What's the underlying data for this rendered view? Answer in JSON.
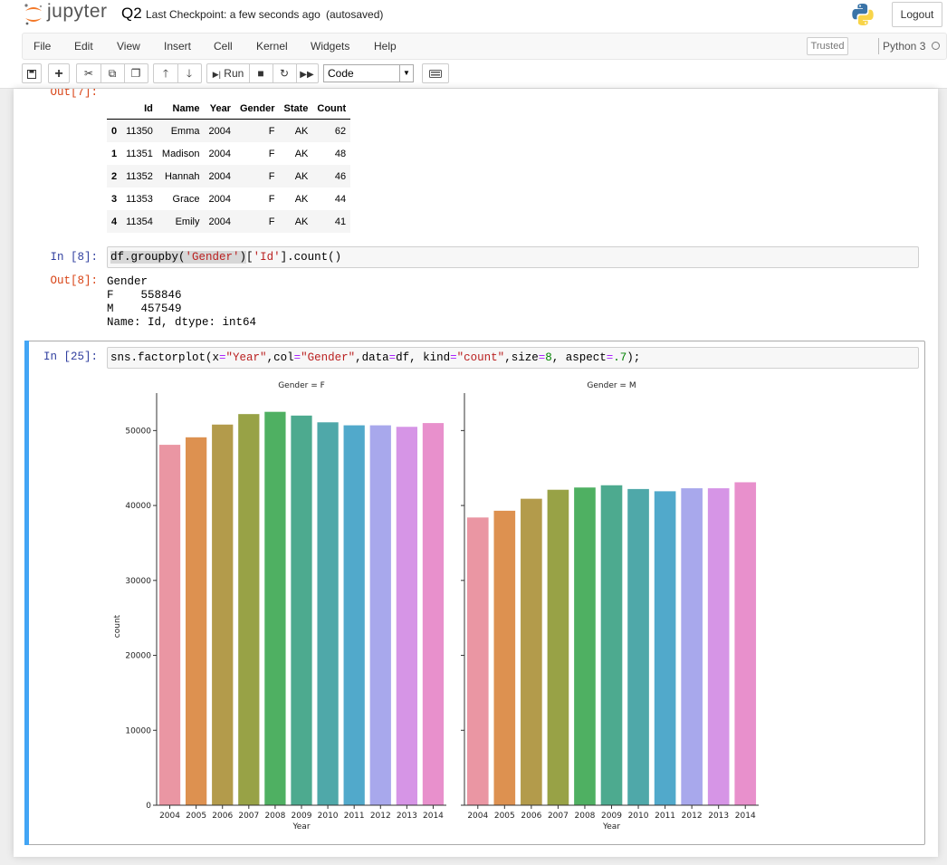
{
  "header": {
    "logo_text": "jupyter",
    "notebook_name": "Q2",
    "checkpoint": "Last Checkpoint: a few seconds ago",
    "autosave": "(autosaved)",
    "logout_label": "Logout"
  },
  "menubar": {
    "items": [
      "File",
      "Edit",
      "View",
      "Insert",
      "Cell",
      "Kernel",
      "Widgets",
      "Help"
    ],
    "trusted_label": "Trusted",
    "kernel_name": "Python 3"
  },
  "toolbar": {
    "run_label": "Run",
    "cell_type": "Code"
  },
  "cells": {
    "out7": {
      "prompt": "Out[7]:",
      "columns": [
        "",
        "Id",
        "Name",
        "Year",
        "Gender",
        "State",
        "Count"
      ],
      "rows": [
        [
          "0",
          "11350",
          "Emma",
          "2004",
          "F",
          "AK",
          "62"
        ],
        [
          "1",
          "11351",
          "Madison",
          "2004",
          "F",
          "AK",
          "48"
        ],
        [
          "2",
          "11352",
          "Hannah",
          "2004",
          "F",
          "AK",
          "46"
        ],
        [
          "3",
          "11353",
          "Grace",
          "2004",
          "F",
          "AK",
          "44"
        ],
        [
          "4",
          "11354",
          "Emily",
          "2004",
          "F",
          "AK",
          "41"
        ]
      ]
    },
    "in8": {
      "prompt": "In [8]:",
      "code": "df.groupby('Gender')['Id'].count()"
    },
    "out8": {
      "prompt": "Out[8]:",
      "lines": [
        "Gender",
        "F    558846",
        "M    457549",
        "Name: Id, dtype: int64"
      ]
    },
    "in25": {
      "prompt": "In [25]:",
      "code": "sns.factorplot(x=\"Year\",col=\"Gender\",data=df, kind=\"count\",size=8, aspect=.7);"
    }
  },
  "chart_data": [
    {
      "type": "bar",
      "title": "Gender = F",
      "xlabel": "Year",
      "ylabel": "count",
      "categories": [
        "2004",
        "2005",
        "2006",
        "2007",
        "2008",
        "2009",
        "2010",
        "2011",
        "2012",
        "2013",
        "2014"
      ],
      "values": [
        48100,
        49100,
        50800,
        52200,
        52500,
        52000,
        51100,
        50700,
        50700,
        50500,
        51000
      ],
      "ylim": [
        0,
        55000
      ],
      "yticks": [
        0,
        10000,
        20000,
        30000,
        40000,
        50000
      ],
      "colors": [
        "#ea96a3",
        "#dd9150",
        "#b39b4b",
        "#98a246",
        "#4fb062",
        "#4daa8f",
        "#4fa8a9",
        "#51a9cb",
        "#a8a8ec",
        "#d695e6",
        "#e890cc"
      ]
    },
    {
      "type": "bar",
      "title": "Gender = M",
      "xlabel": "Year",
      "ylabel": "",
      "categories": [
        "2004",
        "2005",
        "2006",
        "2007",
        "2008",
        "2009",
        "2010",
        "2011",
        "2012",
        "2013",
        "2014"
      ],
      "values": [
        38400,
        39300,
        40900,
        42100,
        42400,
        42700,
        42200,
        41900,
        42300,
        42300,
        43100
      ],
      "ylim": [
        0,
        55000
      ],
      "colors": [
        "#ea96a3",
        "#dd9150",
        "#b39b4b",
        "#98a246",
        "#4fb062",
        "#4daa8f",
        "#4fa8a9",
        "#51a9cb",
        "#a8a8ec",
        "#d695e6",
        "#e890cc"
      ]
    }
  ]
}
